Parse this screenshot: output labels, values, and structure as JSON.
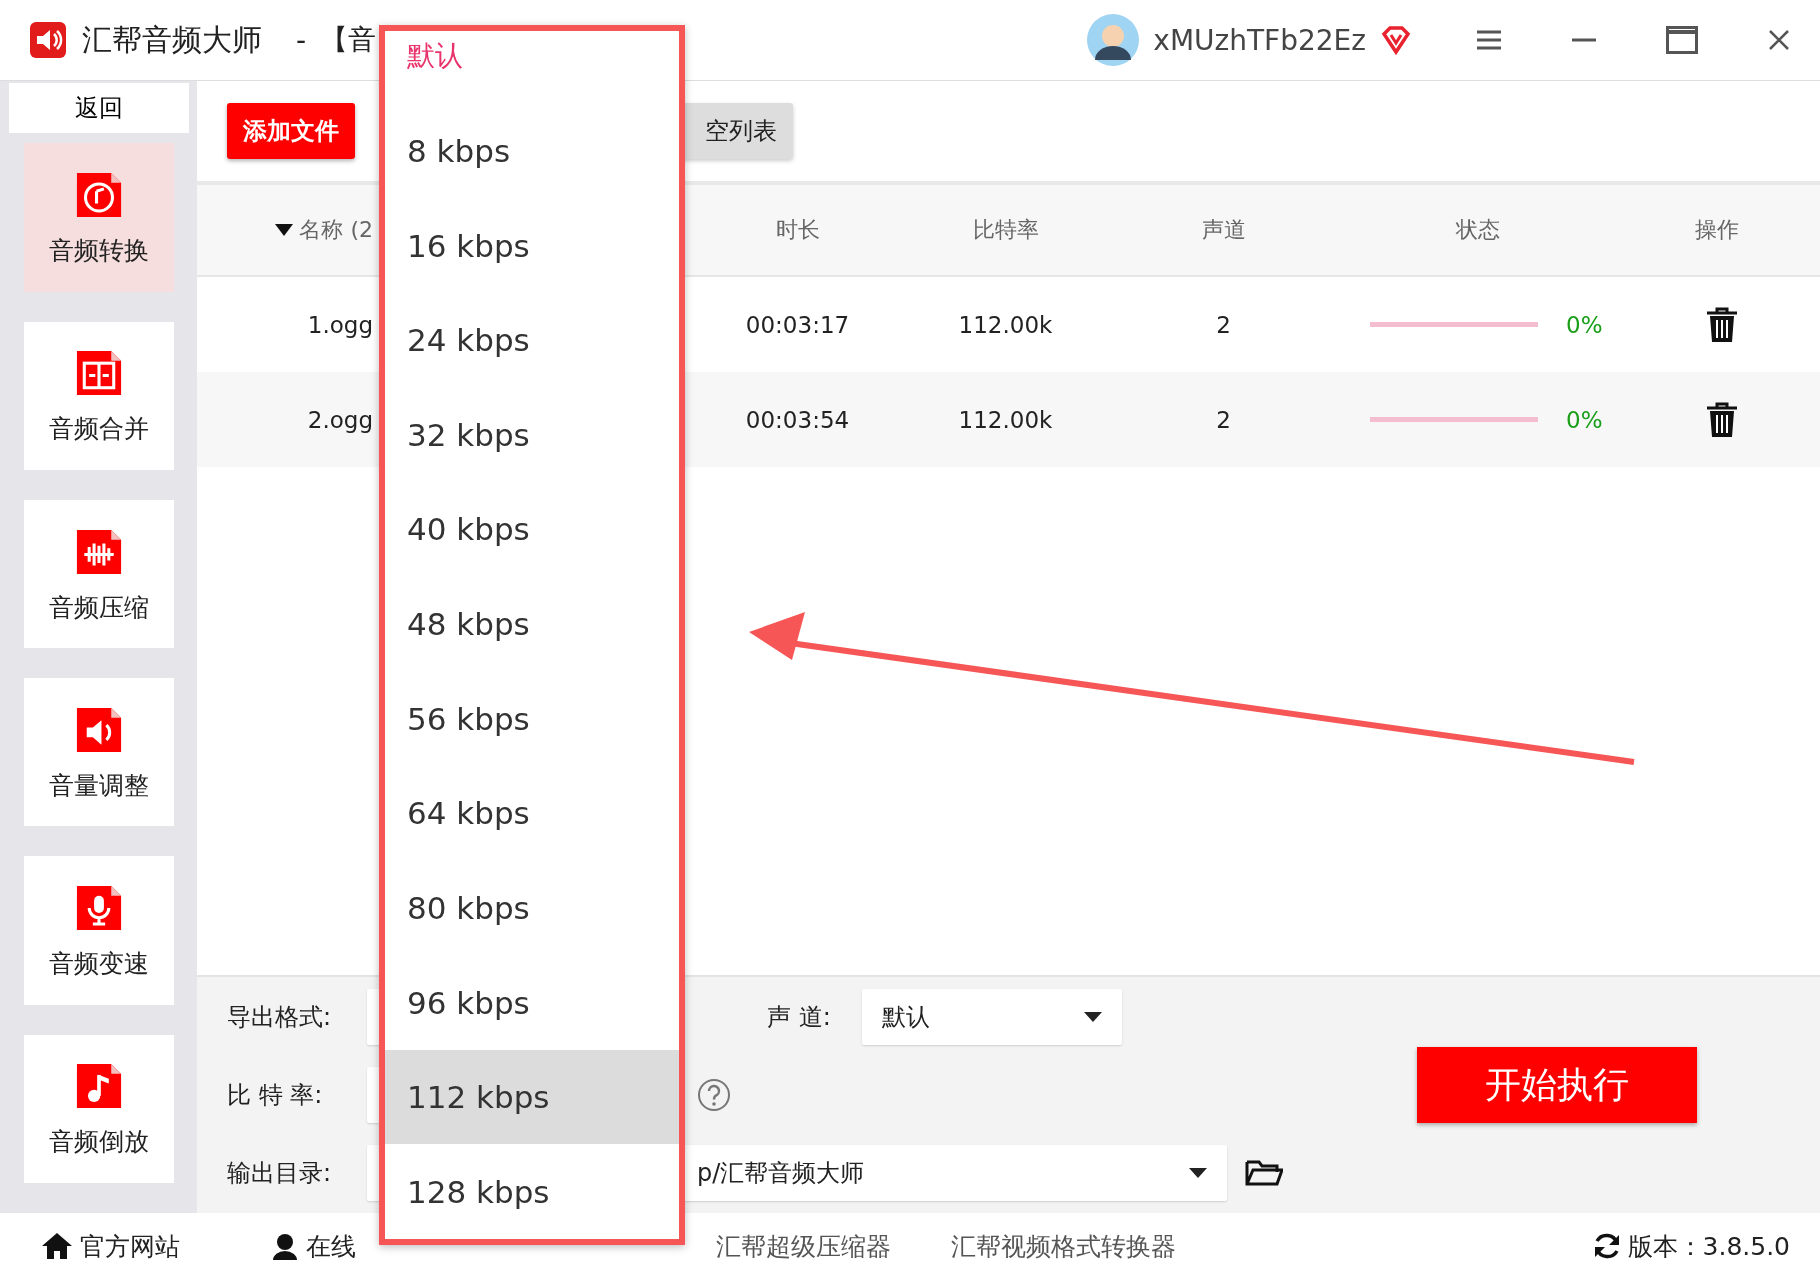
{
  "window": {
    "app_name": "汇帮音频大师",
    "separator": "-",
    "page": "【音",
    "user": "xMUzhTFb22Ez"
  },
  "sidebar": {
    "back": "返回",
    "items": [
      {
        "label": "音频转换",
        "selected": true
      },
      {
        "label": "音频合并",
        "selected": false
      },
      {
        "label": "音频压缩",
        "selected": false
      },
      {
        "label": "音量调整",
        "selected": false
      },
      {
        "label": "音频变速",
        "selected": false
      },
      {
        "label": "音频倒放",
        "selected": false
      }
    ]
  },
  "toolbar": {
    "add_file": "添加文件",
    "clear": "空列表"
  },
  "table": {
    "columns": [
      "名称 (2",
      "时长",
      "比特率",
      "声道",
      "状态",
      "操作"
    ],
    "rows": [
      {
        "name": "1.ogg",
        "duration": "00:03:17",
        "bitrate": "112.00k",
        "channels": "2",
        "level": 0,
        "percent": "0%"
      },
      {
        "name": "2.ogg",
        "duration": "00:03:54",
        "bitrate": "112.00k",
        "channels": "2",
        "level": 0,
        "percent": "0%"
      }
    ]
  },
  "settings": {
    "format_label": "导出格式:",
    "channel_label": "声 道:",
    "channel_value": "默认",
    "bitrate_label": "比 特 率:",
    "output_label": "输出目录:",
    "output_value": "p/汇帮音频大师",
    "start": "开始执行"
  },
  "dropdown": {
    "items": [
      {
        "label": "默认",
        "selected": true,
        "hovered": false
      },
      {
        "label": "8 kbps",
        "selected": false,
        "hovered": false
      },
      {
        "label": "16 kbps",
        "selected": false,
        "hovered": false
      },
      {
        "label": "24 kbps",
        "selected": false,
        "hovered": false
      },
      {
        "label": "32 kbps",
        "selected": false,
        "hovered": false
      },
      {
        "label": "40 kbps",
        "selected": false,
        "hovered": false
      },
      {
        "label": "48 kbps",
        "selected": false,
        "hovered": false
      },
      {
        "label": "56 kbps",
        "selected": false,
        "hovered": false
      },
      {
        "label": "64 kbps",
        "selected": false,
        "hovered": false
      },
      {
        "label": "80 kbps",
        "selected": false,
        "hovered": false
      },
      {
        "label": "96 kbps",
        "selected": false,
        "hovered": false
      },
      {
        "label": "112 kbps",
        "selected": false,
        "hovered": true
      },
      {
        "label": "128 kbps",
        "selected": false,
        "hovered": false
      }
    ]
  },
  "footer": {
    "website": "官方网站",
    "support": "在线",
    "links": [
      "汇帮超级压缩器",
      "汇帮视频格式转换器"
    ],
    "version": "版本：3.8.5.0"
  }
}
